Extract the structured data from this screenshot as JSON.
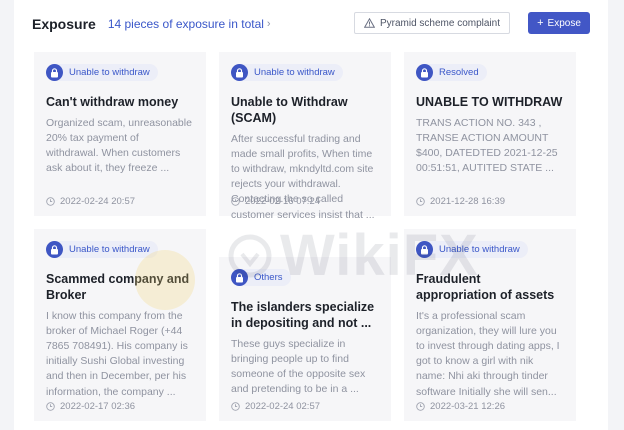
{
  "header": {
    "title": "Exposure",
    "count_link": "14 pieces of exposure in total",
    "complaint_button": "Pyramid scheme complaint",
    "expose_button": "Expose"
  },
  "watermark": "WikiFX",
  "cards": [
    {
      "tag": "Unable to withdraw",
      "title": "Can't withdraw money",
      "body": "Organized scam, unreasonable 20% tax payment of withdrawal. When customers ask about it, they freeze ...",
      "date": "2022-02-24 20:57"
    },
    {
      "tag": "Unable to withdraw",
      "title": "Unable to Withdraw (SCAM)",
      "body": "After successful trading and made small profits, When time to withdraw, mkndyltd.com site rejects your withdrawal. Contacting the so called customer services insist that ...",
      "date": "2022-02-16 07:24"
    },
    {
      "tag": "Resolved",
      "title": "UNABLE TO WITHDRAW",
      "body": "TRANS ACTION NO. 343 , TRANSE ACTION AMOUNT $400, DATEDTED 2021-12-25 00:51:51, AUTITED STATE ...",
      "date": "2021-12-28 16:39"
    },
    {
      "tag": "Unable to withdraw",
      "title": "Scammed company and Broker",
      "body": "I know this company from the broker of Michael Roger (+44 7865 708491). His company is initially Sushi Global investing and then in December, per his information, the company ...",
      "date": "2022-02-17 02:36"
    },
    {
      "tag": "Others",
      "title": "The islanders specialize in depositing and not ...",
      "body": "These guys specialize in bringing people up to find someone of the opposite sex and pretending to be in a ...",
      "date": "2022-02-24 02:57"
    },
    {
      "tag": "Unable to withdraw",
      "title": "Fraudulent appropriation of assets",
      "body": "It's a professional scam organization, they will lure you to invest through dating apps, I got to know a girl with nik name: Nhi aki through tinder software Initially she will sen...",
      "date": "2022-03-21 12:26"
    }
  ],
  "colors": {
    "accent": "#4257c6",
    "tag_text": "#3a57c9",
    "card_bg": "#f6f6f8",
    "muted_text": "#8f93a0"
  },
  "icons": {
    "tag": "lock-shield-icon",
    "date": "clock-icon",
    "complaint": "warning-icon",
    "expose": "plus-icon",
    "count_link": "chevron-right-icon"
  }
}
